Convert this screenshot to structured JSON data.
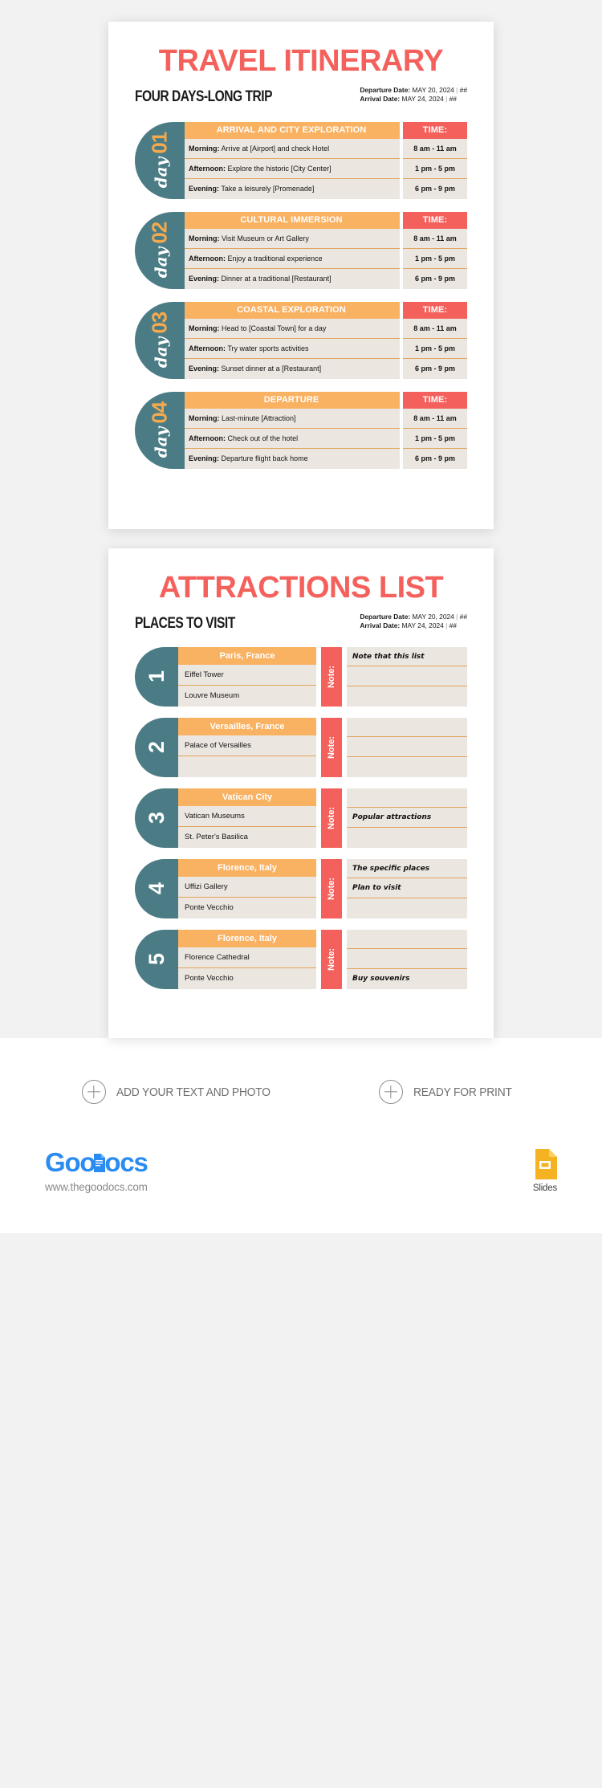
{
  "itinerary": {
    "title": "TRAVEL ITINERARY",
    "subtitle": "FOUR DAYS-LONG TRIP",
    "departure_label": "Departure Date:",
    "departure_value": "MAY 20, 2024",
    "departure_extra": "##",
    "arrival_label": "Arrival Date:",
    "arrival_value": "MAY 24, 2024",
    "arrival_extra": "##",
    "time_header": "TIME:",
    "day_word": "day",
    "days": [
      {
        "number": "01",
        "heading": "ARRIVAL AND CITY EXPLORATION",
        "rows": [
          {
            "label": "Morning:",
            "text": "Arrive at [Airport] and check Hotel",
            "time": "8 am - 11 am"
          },
          {
            "label": "Afternoon:",
            "text": "Explore the historic [City Center]",
            "time": "1 pm - 5 pm"
          },
          {
            "label": "Evening:",
            "text": "Take a leisurely [Promenade]",
            "time": "6  pm - 9 pm"
          }
        ]
      },
      {
        "number": "02",
        "heading": "CULTURAL IMMERSION",
        "rows": [
          {
            "label": "Morning:",
            "text": "Visit Museum or Art Gallery",
            "time": "8 am - 11 am"
          },
          {
            "label": "Afternoon:",
            "text": "Enjoy a traditional experience",
            "time": "1 pm - 5 pm"
          },
          {
            "label": "Evening:",
            "text": "Dinner at a traditional [Restaurant]",
            "time": "6  pm - 9 pm"
          }
        ]
      },
      {
        "number": "03",
        "heading": "COASTAL EXPLORATION",
        "rows": [
          {
            "label": "Morning:",
            "text": "Head to [Coastal Town] for a day",
            "time": "8 am - 11 am"
          },
          {
            "label": "Afternoon:",
            "text": "Try water sports activities",
            "time": "1 pm - 5 pm"
          },
          {
            "label": "Evening:",
            "text": "Sunset dinner at a [Restaurant]",
            "time": "6  pm - 9 pm"
          }
        ]
      },
      {
        "number": "04",
        "heading": "DEPARTURE",
        "rows": [
          {
            "label": "Morning:",
            "text": "Last-minute [Attraction]",
            "time": "8 am - 11 am"
          },
          {
            "label": "Afternoon:",
            "text": "Check out of the hotel",
            "time": "1 pm - 5 pm"
          },
          {
            "label": "Evening:",
            "text": "Departure flight back home",
            "time": "6  pm - 9 pm"
          }
        ]
      }
    ]
  },
  "attractions": {
    "title": "ATTRACTIONS LIST",
    "subtitle": "PLACES TO VISIT",
    "departure_label": "Departure Date:",
    "departure_value": "MAY 20, 2024",
    "departure_extra": "##",
    "arrival_label": "Arrival Date:",
    "arrival_value": "MAY 24, 2024",
    "arrival_extra": "##",
    "note_label": "Note:",
    "rows": [
      {
        "number": "1",
        "place": "Paris, France",
        "items": [
          "Eiffel Tower",
          "Louvre Museum"
        ],
        "notes": [
          "Note that this list",
          "",
          ""
        ]
      },
      {
        "number": "2",
        "place": "Versailles, France",
        "items": [
          "Palace of Versailles",
          ""
        ],
        "notes": [
          "",
          "",
          ""
        ]
      },
      {
        "number": "3",
        "place": "Vatican City",
        "items": [
          "Vatican Museums",
          "St. Peter's Basilica"
        ],
        "notes": [
          "",
          "Popular attractions",
          ""
        ]
      },
      {
        "number": "4",
        "place": "Florence, Italy",
        "items": [
          "Uffizi Gallery",
          "Ponte Vecchio"
        ],
        "notes": [
          "The specific places",
          "Plan to visit",
          ""
        ]
      },
      {
        "number": "5",
        "place": "Florence, Italy",
        "items": [
          "Florence Cathedral",
          "Ponte Vecchio"
        ],
        "notes": [
          "",
          "",
          "Buy souvenirs"
        ]
      }
    ]
  },
  "footer": {
    "cta_add": "ADD YOUR TEXT AND PHOTO",
    "cta_print": "READY FOR PRINT",
    "brand_goo": "Goo",
    "brand_ocs": "ocs",
    "brand_url": "www.thegoodocs.com",
    "slides_label": "Slides"
  },
  "colors": {
    "accent_red": "#f4615c",
    "accent_orange": "#f9b162",
    "teal": "#4b7c85",
    "cell_bg": "#ece6e0",
    "rule": "#e0a45c",
    "brand_blue": "#2a8cf0",
    "slides_yellow": "#f5b324"
  }
}
